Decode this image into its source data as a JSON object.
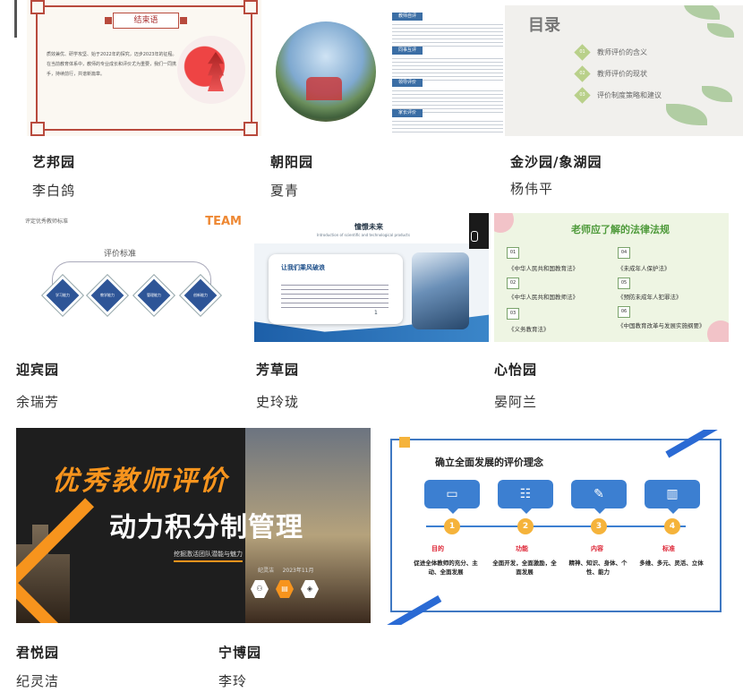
{
  "cards": [
    {
      "garden": "艺邦园",
      "teacher": "李白鸽",
      "thumb": {
        "title": "结束语",
        "body": "质效兼优、研学攻坚、始于2022年的探究，迈步2023年的征程。在当前教育体系中，教师的专业成长和评价尤为重要，我们一同携手，持续前行，共谱新篇章。"
      }
    },
    {
      "garden": "朝阳园",
      "teacher": "夏青"
    },
    {
      "garden": "金沙园/象湖园",
      "teacher": "杨伟平",
      "thumb": {
        "tags": [
          "教师自评",
          "同事互评",
          "领导评价",
          "家长评价"
        ],
        "toc_title": "目录",
        "items": [
          {
            "num": "01",
            "text": "教师评价的含义"
          },
          {
            "num": "02",
            "text": "教师评价的现状"
          },
          {
            "num": "03",
            "text": "评价制度策略和建议"
          }
        ]
      }
    },
    {
      "garden": "迎宾园",
      "teacher": "余瑞芳",
      "thumb": {
        "header": "评定优秀教师标准",
        "logo": "TEAM",
        "title": "评价标准",
        "diamonds": [
          "学习能力",
          "教学能力",
          "管理能力",
          "创新能力"
        ]
      }
    },
    {
      "garden": "芳草园",
      "teacher": "史玲珑",
      "thumb": {
        "title": "憧憬未来",
        "subtitle": "Introduction of scientific and technological products",
        "box_title": "让我们乘风破浪",
        "page": "1"
      }
    },
    {
      "garden": "心怡园",
      "teacher": "晏阿兰",
      "thumb": {
        "title": "老师应了解的法律法规",
        "laws": [
          {
            "num": "01",
            "text": "《中华人民共和国教育法》"
          },
          {
            "num": "02",
            "text": "《中华人民共和国教师法》"
          },
          {
            "num": "03",
            "text": "《义务教育法》"
          },
          {
            "num": "04",
            "text": "《未成年人保护法》"
          },
          {
            "num": "05",
            "text": "《预防未成年人犯罪法》"
          },
          {
            "num": "06",
            "text": "《中国教育改革与发展实施纲要》"
          }
        ]
      }
    },
    {
      "garden": "君悦园",
      "teacher": "纪灵洁",
      "thumb": {
        "title1": "优秀教师评价",
        "title2": "动力积分制管理",
        "subtitle": "挖掘激活团队潜能与魅力",
        "presenter": "纪灵洁",
        "date": "2023年11月"
      }
    },
    {
      "garden": "宁博园",
      "teacher": "李玲",
      "thumb": {
        "title": "确立全面发展的评价理念",
        "steps": [
          {
            "num": "1",
            "label": "目的",
            "desc": "促进全体教师的充分、主动、全面发展"
          },
          {
            "num": "2",
            "label": "功能",
            "desc": "全面开发，全面激励，全面发展"
          },
          {
            "num": "3",
            "label": "内容",
            "desc": "精神、知识、身体、个性、能力"
          },
          {
            "num": "4",
            "label": "标准",
            "desc": "多维、多元、灵活、立体"
          }
        ]
      }
    }
  ]
}
